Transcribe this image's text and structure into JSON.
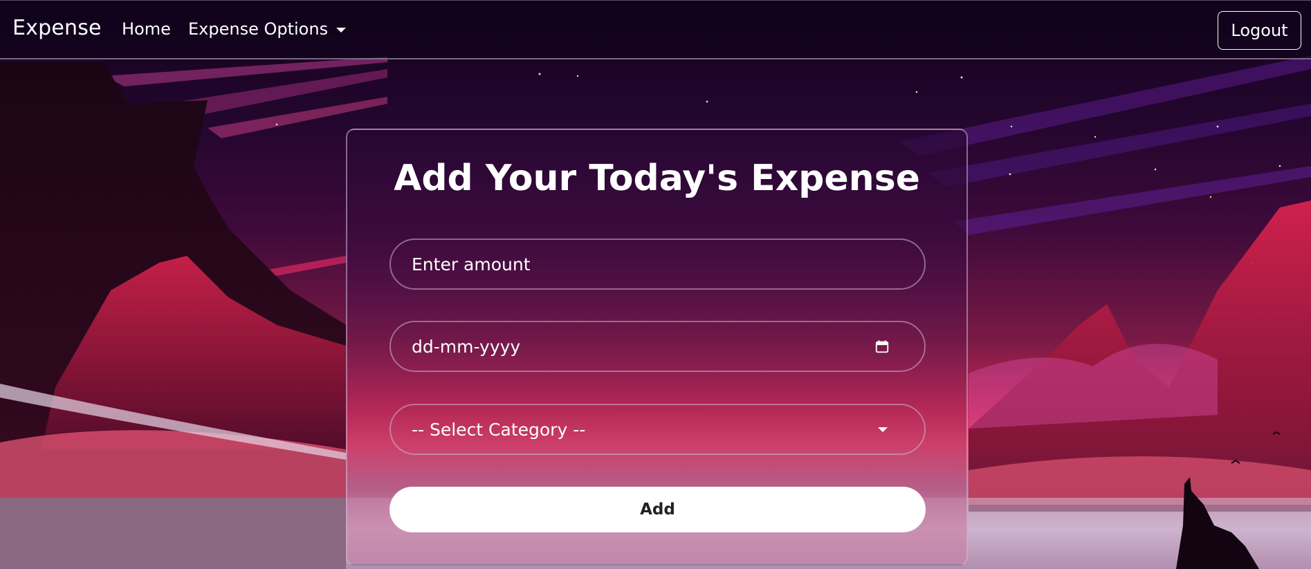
{
  "navbar": {
    "brand": "Expense",
    "home_label": "Home",
    "options_label": "Expense Options",
    "logout_label": "Logout"
  },
  "form": {
    "title": "Add Your Today's Expense",
    "amount_placeholder": "Enter amount",
    "date_placeholder": "dd-mm-yyyy",
    "category_selected": "-- Select Category --",
    "submit_label": "Add"
  },
  "icons": {
    "dropdown": "chevron-down-icon",
    "date": "calendar-icon",
    "select": "chevron-down-icon"
  },
  "colors": {
    "button_bg": "#ffffff",
    "button_text": "#222222",
    "accent_sky": "#c92a55"
  }
}
